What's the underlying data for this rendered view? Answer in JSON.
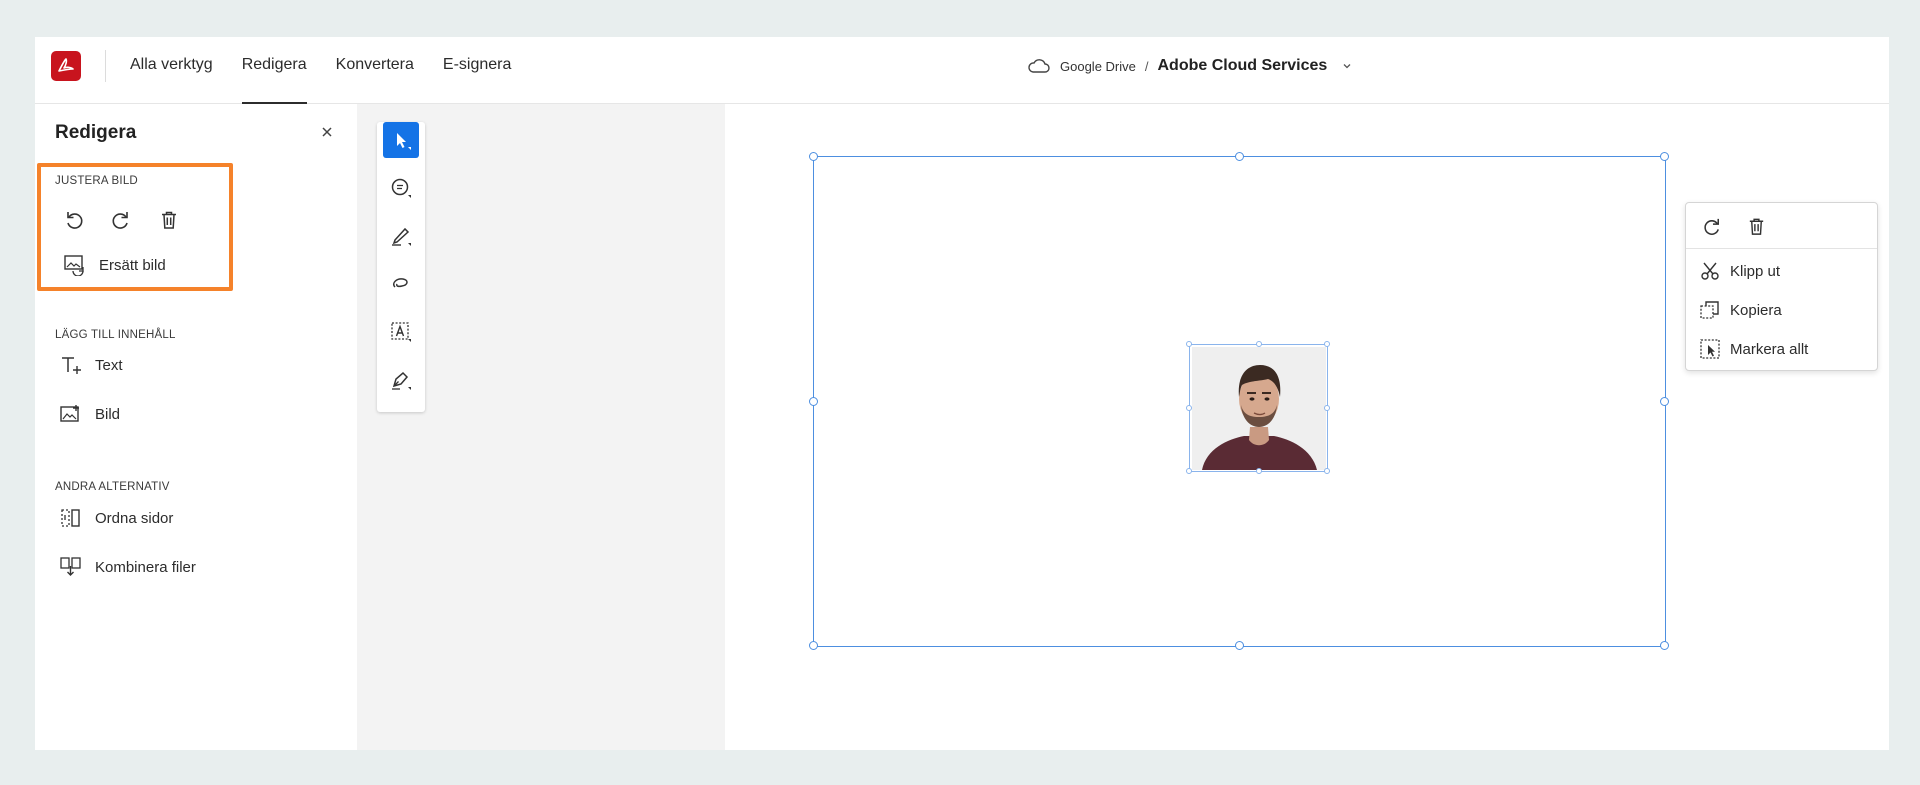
{
  "app": {
    "logo_icon": "acrobat-logo-icon",
    "brand_color": "#c8141e",
    "accent_color": "#1473e6",
    "highlight_color": "#f5822a"
  },
  "topbar": {
    "nav": [
      {
        "label": "Alla verktyg",
        "active": false
      },
      {
        "label": "Redigera",
        "active": true
      },
      {
        "label": "Konvertera",
        "active": false
      },
      {
        "label": "E-signera",
        "active": false
      }
    ],
    "breadcrumb": {
      "location": "Google Drive",
      "separator": "/",
      "service": "Adobe Cloud Services"
    }
  },
  "panel": {
    "title": "Redigera",
    "sections": {
      "adjust": {
        "header": "JUSTERA BILD",
        "replace_label": "Ersätt bild"
      },
      "add": {
        "header": "LÄGG TILL INNEHÅLL",
        "text_label": "Text",
        "image_label": "Bild"
      },
      "other": {
        "header": "ANDRA ALTERNATIV",
        "organize_label": "Ordna sidor",
        "combine_label": "Kombinera filer"
      }
    }
  },
  "toolbar": {
    "tools": [
      "select-icon",
      "comment-icon",
      "highlight-pen-icon",
      "lasso-icon",
      "text-box-icon",
      "sign-pen-icon"
    ]
  },
  "context_menu": {
    "cut_label": "Klipp ut",
    "copy_label": "Kopiera",
    "select_all_label": "Markera allt"
  }
}
